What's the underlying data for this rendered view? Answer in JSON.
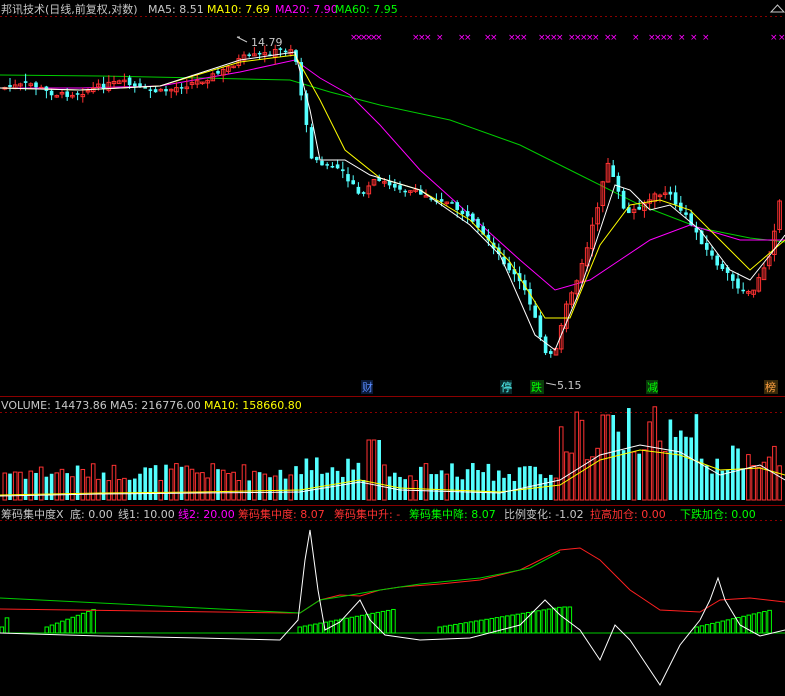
{
  "title_bar": {
    "title": "邦讯技术(日线,前复权,对数)",
    "ma5": "MA5: 8.51",
    "ma10": "MA10: 7.69",
    "ma20": "MA20: 7.90",
    "ma60": "MA60: 7.95"
  },
  "volume_header": {
    "volume": "VOLUME: 14473.86",
    "ma5": "MA5: 216776.00",
    "ma10": "MA10: 158660.80"
  },
  "indicator_header": {
    "name": "筹码集中度X",
    "bottom": "底: 0.00",
    "line1": "线1: 10.00",
    "line2": "线2: 20.00",
    "concentration": "筹码集中度: 8.07",
    "rise": "筹码集中升: -",
    "fall": "筹码集中降: 8.07",
    "ratio": "比例变化: -1.02",
    "pull_add": "拉高加仓: 0.00",
    "drop_add": "下跌加仓: 0.00"
  },
  "annotations": {
    "high_price": "14.79",
    "low_price": "5.15",
    "events": [
      "财",
      "停",
      "跌",
      "减",
      "榜"
    ]
  },
  "colors": {
    "up": "#ff3232",
    "down": "#54ffff",
    "ma5": "#ffffff",
    "ma10": "#ffff00",
    "ma20": "#ff00ff",
    "ma60": "#00cc00",
    "dots": "#ff00ff",
    "grid": "#8b0000"
  },
  "chart_data": {
    "type": "candlestick+volume+indicator",
    "y_range_price": [
      4.6,
      16.0
    ],
    "price_high_marked": 14.79,
    "price_low_marked": 5.15,
    "ma_last": {
      "MA5": 8.51,
      "MA10": 7.69,
      "MA20": 7.9,
      "MA60": 7.95
    },
    "volume_last": 14473.86,
    "volume_ma_last": {
      "MA5": 216776.0,
      "MA10": 158660.8
    },
    "indicator_last": {
      "底": 0.0,
      "线1": 10.0,
      "线2": 20.0,
      "筹码集中度": 8.07,
      "筹码集中降": 8.07,
      "比例变化": -1.02,
      "拉高加仓": 0.0,
      "下跌加仓": 0.0
    }
  }
}
